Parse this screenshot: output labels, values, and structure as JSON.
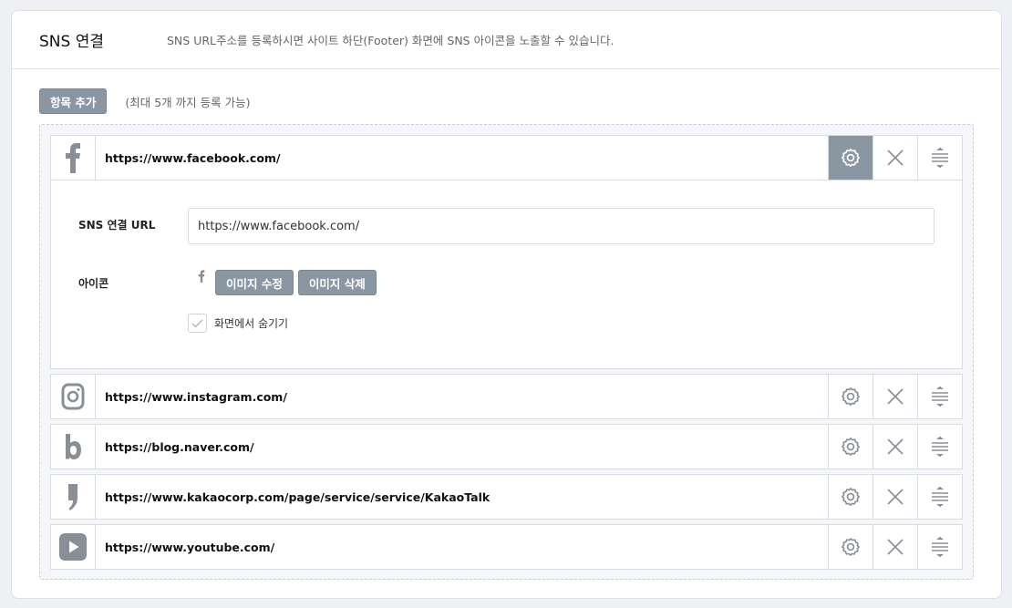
{
  "header": {
    "title": "SNS 연결",
    "description": "SNS URL주소를 등록하시면 사이트 하단(Footer) 화면에 SNS 아이콘을 노출할 수 있습니다."
  },
  "toolbar": {
    "add_label": "항목 추가",
    "limit_note": "(최대 5개 까지 등록 가능)"
  },
  "items": [
    {
      "icon": "facebook-icon",
      "url": "https://www.facebook.com/",
      "expanded": true
    },
    {
      "icon": "instagram-icon",
      "url": "https://www.instagram.com/"
    },
    {
      "icon": "naver-blog-icon",
      "url": "https://blog.naver.com/"
    },
    {
      "icon": "kakaotalk-icon",
      "url": "https://www.kakaocorp.com/page/service/service/KakaoTalk"
    },
    {
      "icon": "youtube-icon",
      "url": "https://www.youtube.com/"
    }
  ],
  "detail": {
    "url_label": "SNS 연결 URL",
    "url_value": "https://www.facebook.com/",
    "icon_label": "아이콘",
    "edit_image_label": "이미지 수정",
    "delete_image_label": "이미지 삭제",
    "hide_label": "화면에서 숨기기"
  },
  "colors": {
    "button_gray": "#8b96a3",
    "icon_gray": "#8a8f96",
    "border": "#d9dde3"
  }
}
